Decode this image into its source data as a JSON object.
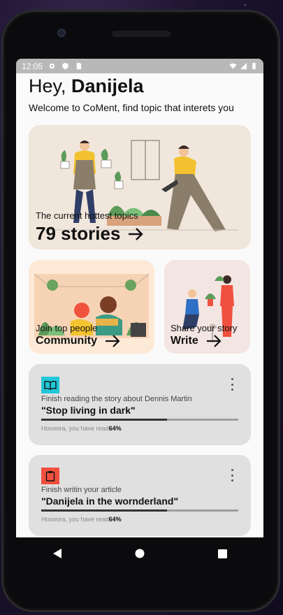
{
  "status_bar": {
    "time": "12:05",
    "icons": [
      "gear-icon",
      "shield-icon",
      "sim-card-icon",
      "wifi-icon",
      "signal-icon",
      "battery-icon"
    ]
  },
  "header": {
    "greeting": "Hey,",
    "username": "Danijela",
    "welcome": "Welcome to CoMent, find topic that interets you"
  },
  "hot_card": {
    "subtitle": "The current hottest topics",
    "title": "79 stories",
    "illustration": "gardening-people-illustration"
  },
  "community_card": {
    "subtitle": "Join top people",
    "title": "Community",
    "illustration": "people-with-plants-illustration"
  },
  "write_card": {
    "subtitle": "Share your story",
    "title": "Write",
    "illustration": "people-watering-plants-illustration"
  },
  "tasks": [
    {
      "icon": "book-icon",
      "icon_color": "#22c7d8",
      "subtitle": "Finish reading the story about Dennis Martin",
      "title": "\"Stop living in dark\"",
      "progress_text": "Hoooora, you have read",
      "progress_value": "64%",
      "progress": 0.64
    },
    {
      "icon": "clipboard-icon",
      "icon_color": "#f0503f",
      "subtitle": "Finish writin your article",
      "title": "\"Danijela in the wornderland\"",
      "progress_text": "Hoooora, you have read",
      "progress_value": "64%",
      "progress": 0.64
    }
  ],
  "nav_bar": {
    "buttons": [
      "back-icon",
      "home-icon",
      "recents-icon"
    ]
  },
  "colors": {
    "hot_card_bg": "#f1e6dc",
    "community_card_bg": "#fde9d6",
    "write_card_bg": "#f3e5e1",
    "task_card_bg": "#e0e0e0",
    "status_bar_bg": "#b8b8b8"
  }
}
